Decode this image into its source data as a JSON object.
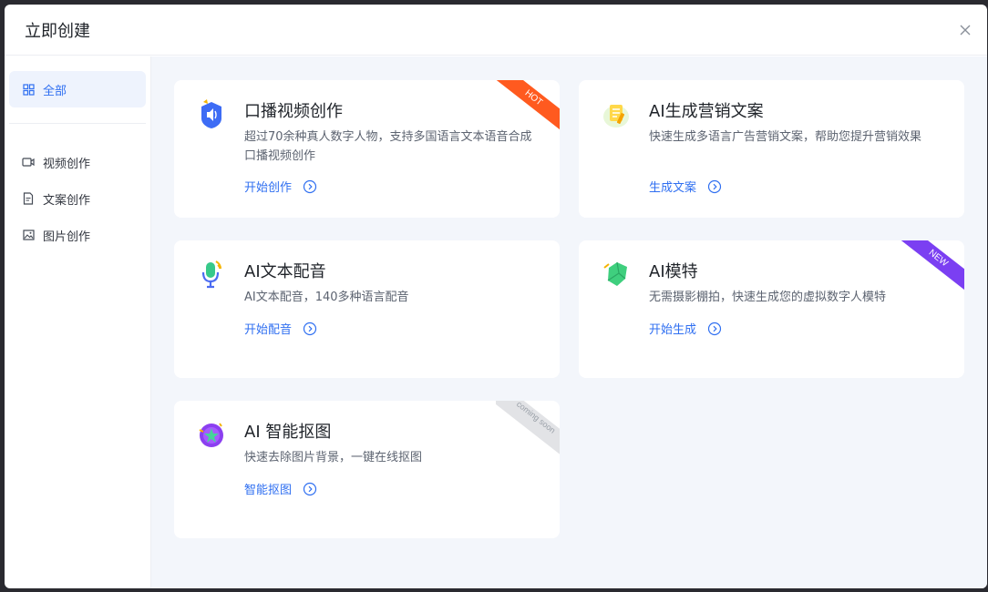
{
  "dialog": {
    "title": "立即创建",
    "close_icon": "close-icon"
  },
  "sidebar": {
    "items": [
      {
        "label": "全部",
        "icon": "grid-icon",
        "active": true
      },
      {
        "label": "视频创作",
        "icon": "video-icon"
      },
      {
        "label": "文案创作",
        "icon": "document-icon"
      },
      {
        "label": "图片创作",
        "icon": "image-icon"
      }
    ]
  },
  "cards": [
    {
      "title": "口播视频创作",
      "desc": "超过70余种真人数字人物，支持多国语言文本语音合成口播视频创作",
      "action": "开始创作",
      "badge": "HOT",
      "icon": "speaker-video-icon"
    },
    {
      "title": "AI生成营销文案",
      "desc": "快速生成多语言广告营销文案，帮助您提升营销效果",
      "action": "生成文案",
      "badge": "",
      "icon": "document-pen-icon"
    },
    {
      "title": "AI文本配音",
      "desc": "AI文本配音，140多种语言配音",
      "action": "开始配音",
      "badge": "",
      "icon": "microphone-icon"
    },
    {
      "title": "AI模特",
      "desc": "无需摄影棚拍，快速生成您的虚拟数字人模特",
      "action": "开始生成",
      "badge": "NEW",
      "icon": "model-icon"
    },
    {
      "title": "AI 智能抠图",
      "desc": "快速去除图片背景，一键在线抠图",
      "action": "智能抠图",
      "badge": "coming soon",
      "icon": "cutout-icon"
    }
  ],
  "colors": {
    "accent": "#2f6ff1",
    "hot": "#ff5a1f",
    "new": "#7b3ff2",
    "soon": "#e2e3e6"
  }
}
